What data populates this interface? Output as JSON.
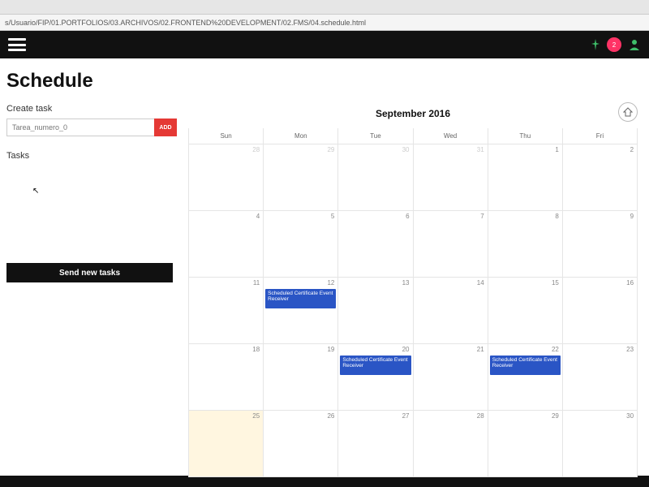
{
  "browser": {
    "url": "s/Usuario/FIP/01.PORTFOLIOS/03.ARCHIVOS/02.FRONTEND%20DEVELOPMENT/02.FMS/04.schedule.html"
  },
  "topbar": {
    "notification_count": "2"
  },
  "page": {
    "title": "Schedule"
  },
  "create": {
    "label": "Create task",
    "placeholder": "Tarea_numero_0",
    "add_label": "Add"
  },
  "tasks": {
    "label": "Tasks",
    "send_label": "Send new tasks"
  },
  "calendar": {
    "title": "September 2016",
    "day_headers": [
      "Sun",
      "Mon",
      "Tue",
      "Wed",
      "Thu",
      "Fri"
    ],
    "weeks": [
      [
        {
          "n": "28",
          "dim": true
        },
        {
          "n": "29",
          "dim": true
        },
        {
          "n": "30",
          "dim": true
        },
        {
          "n": "31",
          "dim": true
        },
        {
          "n": "1"
        },
        {
          "n": "2"
        }
      ],
      [
        {
          "n": "4"
        },
        {
          "n": "5"
        },
        {
          "n": "6"
        },
        {
          "n": "7"
        },
        {
          "n": "8"
        },
        {
          "n": "9"
        }
      ],
      [
        {
          "n": "11"
        },
        {
          "n": "12",
          "event": "Scheduled Certificate Event Receiver"
        },
        {
          "n": "13"
        },
        {
          "n": "14"
        },
        {
          "n": "15"
        },
        {
          "n": "16"
        }
      ],
      [
        {
          "n": "18"
        },
        {
          "n": "19"
        },
        {
          "n": "20",
          "event": "Scheduled Certificate Event Receiver"
        },
        {
          "n": "21"
        },
        {
          "n": "22",
          "event": "Scheduled Certificate Event Receiver"
        },
        {
          "n": "23"
        }
      ],
      [
        {
          "n": "25",
          "highlight": true
        },
        {
          "n": "26"
        },
        {
          "n": "27"
        },
        {
          "n": "28"
        },
        {
          "n": "29"
        },
        {
          "n": "30"
        }
      ]
    ]
  }
}
